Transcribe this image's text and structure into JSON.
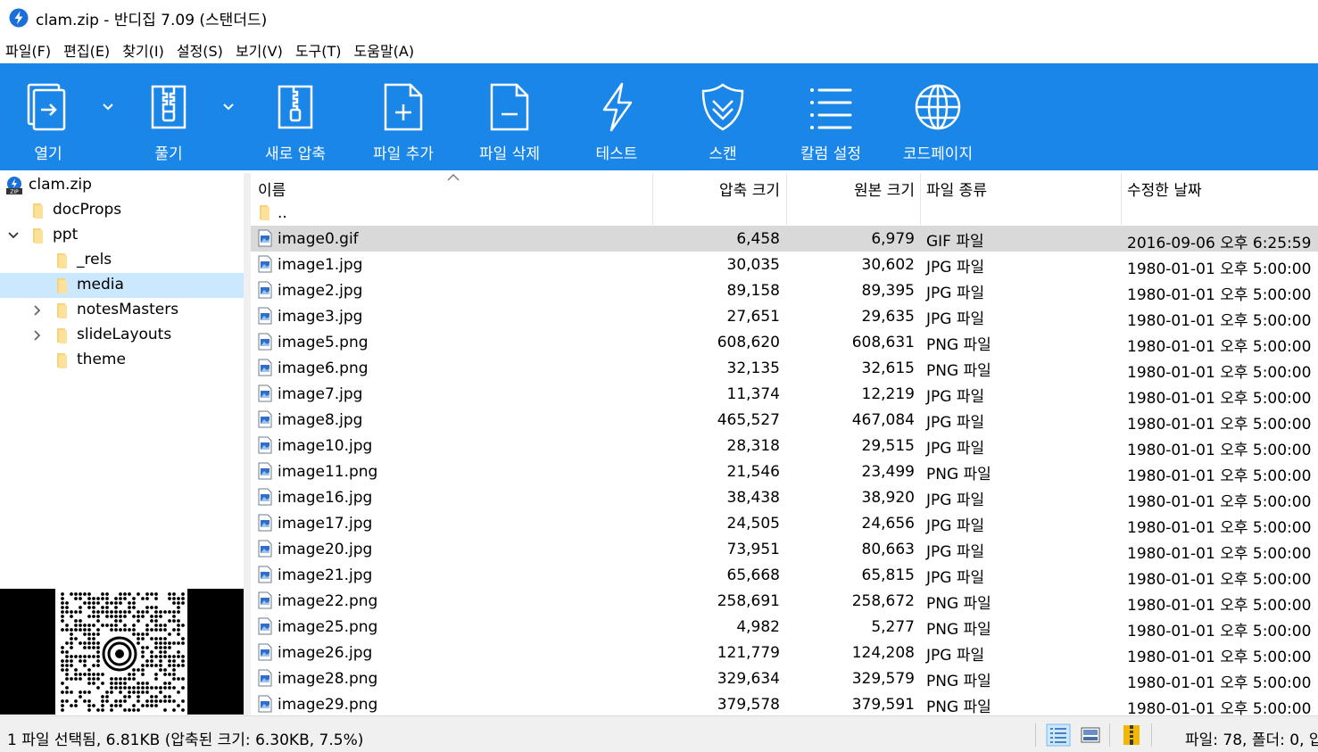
{
  "window": {
    "title": "clam.zip - 반디집 7.09 (스탠더드)"
  },
  "menu": [
    "파일(F)",
    "편집(E)",
    "찾기(I)",
    "설정(S)",
    "보기(V)",
    "도구(T)",
    "도움말(A)"
  ],
  "toolbar": {
    "open": "열기",
    "extract": "풀기",
    "new_archive": "새로 압축",
    "add_file": "파일 추가",
    "delete_file": "파일 삭제",
    "test": "테스트",
    "scan": "스캔",
    "column_settings": "칼럼 설정",
    "codepage": "코드페이지"
  },
  "tree": {
    "root": "clam.zip",
    "items": [
      "docProps",
      "ppt",
      "_rels",
      "media",
      "notesMasters",
      "slideLayouts",
      "theme"
    ]
  },
  "columns": {
    "name": "이름",
    "compressed": "압축 크기",
    "original": "원본 크기",
    "type": "파일 종류",
    "modified": "수정한 날짜"
  },
  "parent_dir": "..",
  "files": [
    {
      "name": "image0.gif",
      "compressed": "6,458",
      "original": "6,979",
      "type": "GIF 파일",
      "modified": "2016-09-06 오후 6:25:59"
    },
    {
      "name": "image1.jpg",
      "compressed": "30,035",
      "original": "30,602",
      "type": "JPG 파일",
      "modified": "1980-01-01 오후 5:00:00"
    },
    {
      "name": "image2.jpg",
      "compressed": "89,158",
      "original": "89,395",
      "type": "JPG 파일",
      "modified": "1980-01-01 오후 5:00:00"
    },
    {
      "name": "image3.jpg",
      "compressed": "27,651",
      "original": "29,635",
      "type": "JPG 파일",
      "modified": "1980-01-01 오후 5:00:00"
    },
    {
      "name": "image5.png",
      "compressed": "608,620",
      "original": "608,631",
      "type": "PNG 파일",
      "modified": "1980-01-01 오후 5:00:00"
    },
    {
      "name": "image6.png",
      "compressed": "32,135",
      "original": "32,615",
      "type": "PNG 파일",
      "modified": "1980-01-01 오후 5:00:00"
    },
    {
      "name": "image7.jpg",
      "compressed": "11,374",
      "original": "12,219",
      "type": "JPG 파일",
      "modified": "1980-01-01 오후 5:00:00"
    },
    {
      "name": "image8.jpg",
      "compressed": "465,527",
      "original": "467,084",
      "type": "JPG 파일",
      "modified": "1980-01-01 오후 5:00:00"
    },
    {
      "name": "image10.jpg",
      "compressed": "28,318",
      "original": "29,515",
      "type": "JPG 파일",
      "modified": "1980-01-01 오후 5:00:00"
    },
    {
      "name": "image11.png",
      "compressed": "21,546",
      "original": "23,499",
      "type": "PNG 파일",
      "modified": "1980-01-01 오후 5:00:00"
    },
    {
      "name": "image16.jpg",
      "compressed": "38,438",
      "original": "38,920",
      "type": "JPG 파일",
      "modified": "1980-01-01 오후 5:00:00"
    },
    {
      "name": "image17.jpg",
      "compressed": "24,505",
      "original": "24,656",
      "type": "JPG 파일",
      "modified": "1980-01-01 오후 5:00:00"
    },
    {
      "name": "image20.jpg",
      "compressed": "73,951",
      "original": "80,663",
      "type": "JPG 파일",
      "modified": "1980-01-01 오후 5:00:00"
    },
    {
      "name": "image21.jpg",
      "compressed": "65,668",
      "original": "65,815",
      "type": "JPG 파일",
      "modified": "1980-01-01 오후 5:00:00"
    },
    {
      "name": "image22.png",
      "compressed": "258,691",
      "original": "258,672",
      "type": "PNG 파일",
      "modified": "1980-01-01 오후 5:00:00"
    },
    {
      "name": "image25.png",
      "compressed": "4,982",
      "original": "5,277",
      "type": "PNG 파일",
      "modified": "1980-01-01 오후 5:00:00"
    },
    {
      "name": "image26.jpg",
      "compressed": "121,779",
      "original": "124,208",
      "type": "JPG 파일",
      "modified": "1980-01-01 오후 5:00:00"
    },
    {
      "name": "image28.png",
      "compressed": "329,634",
      "original": "329,579",
      "type": "PNG 파일",
      "modified": "1980-01-01 오후 5:00:00"
    },
    {
      "name": "image29.png",
      "compressed": "379,578",
      "original": "379,591",
      "type": "PNG 파일",
      "modified": "1980-01-01 오후 5:00:00"
    }
  ],
  "status": {
    "selection": "1 파일 선택됨, 6.81KB (압축된 크기: 6.30KB, 7.5%)",
    "counts": "파일: 78, 폴더: 0, 압"
  },
  "colors": {
    "toolbar": "#1a86e8",
    "tree_selection": "#cce8ff",
    "row_selection": "#d9d9d9"
  }
}
